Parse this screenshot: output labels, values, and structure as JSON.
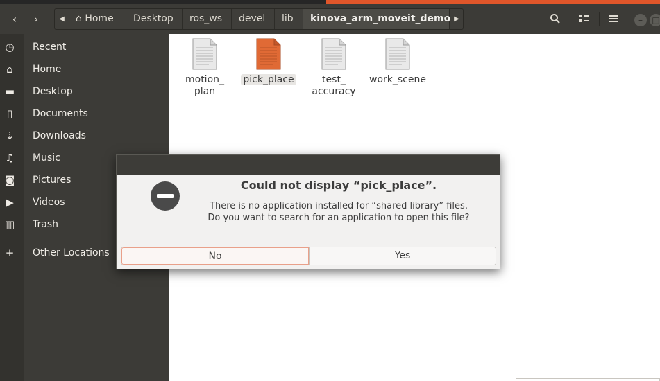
{
  "header": {
    "nav_back": "‹",
    "nav_forward": "›",
    "breadcrumbs": [
      {
        "label": "Home",
        "icon": "home-icon"
      },
      {
        "label": "Desktop"
      },
      {
        "label": "ros_ws"
      },
      {
        "label": "devel"
      },
      {
        "label": "lib"
      },
      {
        "label": "kinova_arm_moveit_demo",
        "active": true
      }
    ],
    "buttons": [
      "search-icon",
      "view-toggle-icon",
      "menu-icon"
    ]
  },
  "sidebar": {
    "items": [
      {
        "label": "Recent",
        "icon": "clock-icon",
        "glyph": "◷"
      },
      {
        "label": "Home",
        "icon": "home-icon",
        "glyph": "⌂"
      },
      {
        "label": "Desktop",
        "icon": "folder-icon",
        "glyph": "▬"
      },
      {
        "label": "Documents",
        "icon": "document-icon",
        "glyph": "▯"
      },
      {
        "label": "Downloads",
        "icon": "download-icon",
        "glyph": "⇣"
      },
      {
        "label": "Music",
        "icon": "music-icon",
        "glyph": "♫"
      },
      {
        "label": "Pictures",
        "icon": "camera-icon",
        "glyph": "◙"
      },
      {
        "label": "Videos",
        "icon": "video-icon",
        "glyph": "▶"
      },
      {
        "label": "Trash",
        "icon": "trash-icon",
        "glyph": "▥"
      },
      {
        "label": "Other Locations",
        "icon": "plus-icon",
        "glyph": "+"
      }
    ]
  },
  "files": [
    {
      "line1": "motion_",
      "line2": "plan",
      "color": "#e4e4e4"
    },
    {
      "line1": "pick_place",
      "line2": "",
      "color": "#e06a35",
      "selected": true
    },
    {
      "line1": "test_",
      "line2": "accuracy",
      "color": "#e4e4e4"
    },
    {
      "line1": "work_scene",
      "line2": "",
      "color": "#e4e4e4"
    }
  ],
  "dialog": {
    "title": "Could not display “pick_place”.",
    "message_line1": "There is no application installed for “shared library” files.",
    "message_line2": "Do you want to search for an application to open this file?",
    "no_label": "No",
    "yes_label": "Yes"
  }
}
